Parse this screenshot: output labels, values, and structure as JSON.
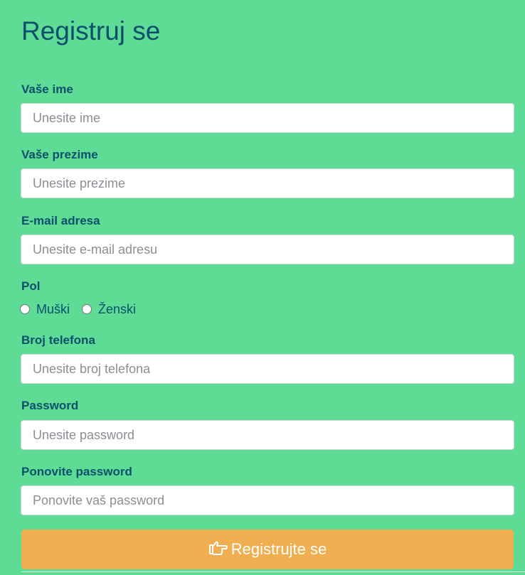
{
  "form": {
    "title": "Registruj se",
    "first_name": {
      "label": "Vaše ime",
      "placeholder": "Unesite ime"
    },
    "last_name": {
      "label": "Vaše prezime",
      "placeholder": "Unesite prezime"
    },
    "email": {
      "label": "E-mail adresa",
      "placeholder": "Unesite e-mail adresu"
    },
    "gender": {
      "label": "Pol",
      "options": [
        "Muški",
        "Ženski"
      ],
      "selected": null
    },
    "phone": {
      "label": "Broj telefona",
      "placeholder": "Unesite broj telefona"
    },
    "password": {
      "label": "Password",
      "placeholder": "Unesite password"
    },
    "confirm_password": {
      "label": "Ponovite password",
      "placeholder": "Ponovite vaš password"
    },
    "submit": {
      "label": "Registrujte se",
      "icon": "hand-point-right-icon"
    }
  },
  "colors": {
    "background": "#5edc95",
    "text": "#0b4f6c",
    "button": "#efae4f",
    "button_text": "#ffffff"
  }
}
